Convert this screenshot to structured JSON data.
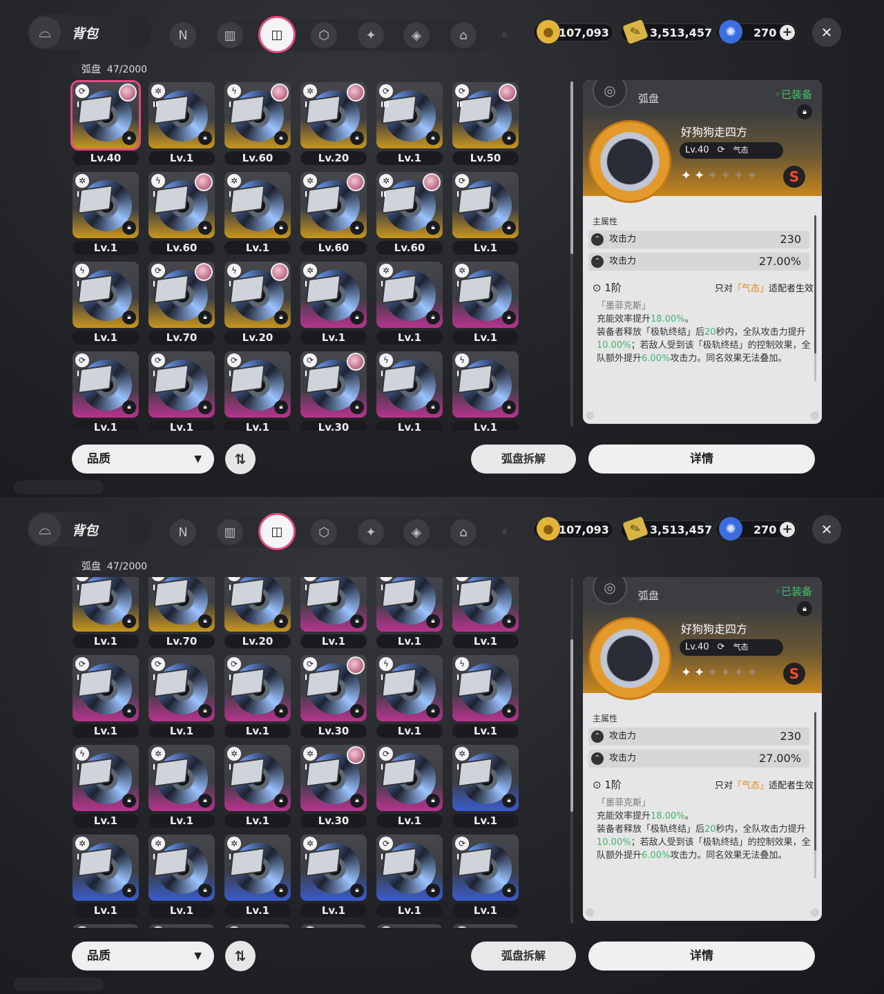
{
  "header": {
    "title": "背包",
    "tabs": [
      {
        "name": "tab-drive-n",
        "icon": "N",
        "active": false
      },
      {
        "name": "tab-device",
        "icon": "▥",
        "active": false
      },
      {
        "name": "tab-disc",
        "icon": "◫",
        "active": true
      },
      {
        "name": "tab-box",
        "icon": "⬡",
        "active": false
      },
      {
        "name": "tab-food",
        "icon": "✦",
        "active": false
      },
      {
        "name": "tab-material",
        "icon": "◈",
        "active": false
      },
      {
        "name": "tab-home",
        "icon": "⌂",
        "active": false
      }
    ],
    "currencies": [
      {
        "name": "gold-coin",
        "value": "107,093",
        "color": "#e3b43a",
        "icon": "●"
      },
      {
        "name": "ticket",
        "value": "3,513,457",
        "color": "#d8b545",
        "icon": "✎"
      },
      {
        "name": "crystal",
        "value": "270",
        "color": "#3b6de0",
        "icon": "✺"
      }
    ],
    "close_icon": "✕"
  },
  "inventory": {
    "category": "弧盘",
    "count": "47/2000"
  },
  "colors": {
    "gold": "#c8961d",
    "purple": "#b8338f",
    "blue": "#3a5bd0",
    "accent": "#e24a80"
  },
  "top_grid": [
    {
      "lv": "Lv.40",
      "q": "gold",
      "rank": "I",
      "attr": "⟳",
      "avatar": true,
      "sel": true
    },
    {
      "lv": "Lv.1",
      "q": "gold",
      "rank": "II",
      "attr": "✲",
      "avatar": false
    },
    {
      "lv": "Lv.60",
      "q": "gold",
      "rank": "I",
      "attr": "ϟ",
      "avatar": true
    },
    {
      "lv": "Lv.20",
      "q": "gold",
      "rank": "I",
      "attr": "✲",
      "avatar": true
    },
    {
      "lv": "Lv.1",
      "q": "gold",
      "rank": "III",
      "attr": "⟳",
      "avatar": false
    },
    {
      "lv": "Lv.50",
      "q": "gold",
      "rank": "II",
      "attr": "⟳",
      "avatar": true
    },
    {
      "lv": "Lv.1",
      "q": "gold",
      "rank": "I",
      "attr": "✲",
      "avatar": false
    },
    {
      "lv": "Lv.60",
      "q": "gold",
      "rank": "I",
      "attr": "ϟ",
      "avatar": true
    },
    {
      "lv": "Lv.1",
      "q": "gold",
      "rank": "I",
      "attr": "✲",
      "avatar": false
    },
    {
      "lv": "Lv.60",
      "q": "gold",
      "rank": "I",
      "attr": "✲",
      "avatar": true
    },
    {
      "lv": "Lv.60",
      "q": "gold",
      "rank": "II",
      "attr": "✲",
      "avatar": true
    },
    {
      "lv": "Lv.1",
      "q": "gold",
      "rank": "I",
      "attr": "⟳",
      "avatar": false
    },
    {
      "lv": "Lv.1",
      "q": "gold",
      "rank": "I",
      "attr": "ϟ",
      "avatar": false
    },
    {
      "lv": "Lv.70",
      "q": "gold",
      "rank": "I",
      "attr": "⟳",
      "avatar": true
    },
    {
      "lv": "Lv.20",
      "q": "gold",
      "rank": "I",
      "attr": "ϟ",
      "avatar": true
    },
    {
      "lv": "Lv.1",
      "q": "purple",
      "rank": "I",
      "attr": "✲",
      "avatar": false
    },
    {
      "lv": "Lv.1",
      "q": "purple",
      "rank": "I",
      "attr": "✲",
      "avatar": false
    },
    {
      "lv": "Lv.1",
      "q": "purple",
      "rank": "I",
      "attr": "✲",
      "avatar": false
    },
    {
      "lv": "Lv.1",
      "q": "purple",
      "rank": "I",
      "attr": "⟳",
      "avatar": false
    },
    {
      "lv": "Lv.1",
      "q": "purple",
      "rank": "I",
      "attr": "⟳",
      "avatar": false
    },
    {
      "lv": "Lv.1",
      "q": "purple",
      "rank": "I",
      "attr": "⟳",
      "avatar": false
    },
    {
      "lv": "Lv.30",
      "q": "purple",
      "rank": "I",
      "attr": "⟳",
      "avatar": true
    },
    {
      "lv": "Lv.1",
      "q": "purple",
      "rank": "I",
      "attr": "ϟ",
      "avatar": false
    },
    {
      "lv": "Lv.1",
      "q": "purple",
      "rank": "I",
      "attr": "ϟ",
      "avatar": false
    }
  ],
  "bottom_grid": [
    {
      "lv": "Lv.1",
      "q": "gold",
      "rank": "I",
      "attr": "ϟ",
      "avatar": false
    },
    {
      "lv": "Lv.70",
      "q": "gold",
      "rank": "I",
      "attr": "⟳",
      "avatar": false
    },
    {
      "lv": "Lv.20",
      "q": "gold",
      "rank": "I",
      "attr": "ϟ",
      "avatar": false
    },
    {
      "lv": "Lv.1",
      "q": "purple",
      "rank": "I",
      "attr": "✲",
      "avatar": false
    },
    {
      "lv": "Lv.1",
      "q": "purple",
      "rank": "I",
      "attr": "✲",
      "avatar": false
    },
    {
      "lv": "Lv.1",
      "q": "purple",
      "rank": "I",
      "attr": "✲",
      "avatar": false
    },
    {
      "lv": "Lv.1",
      "q": "purple",
      "rank": "I",
      "attr": "⟳",
      "avatar": false
    },
    {
      "lv": "Lv.1",
      "q": "purple",
      "rank": "I",
      "attr": "⟳",
      "avatar": false
    },
    {
      "lv": "Lv.1",
      "q": "purple",
      "rank": "I",
      "attr": "⟳",
      "avatar": false
    },
    {
      "lv": "Lv.30",
      "q": "purple",
      "rank": "I",
      "attr": "⟳",
      "avatar": true
    },
    {
      "lv": "Lv.1",
      "q": "purple",
      "rank": "I",
      "attr": "ϟ",
      "avatar": false
    },
    {
      "lv": "Lv.1",
      "q": "purple",
      "rank": "I",
      "attr": "ϟ",
      "avatar": false
    },
    {
      "lv": "Lv.1",
      "q": "purple",
      "rank": "I",
      "attr": "ϟ",
      "avatar": false
    },
    {
      "lv": "Lv.1",
      "q": "purple",
      "rank": "I",
      "attr": "✲",
      "avatar": false
    },
    {
      "lv": "Lv.1",
      "q": "purple",
      "rank": "I",
      "attr": "✲",
      "avatar": false
    },
    {
      "lv": "Lv.30",
      "q": "purple",
      "rank": "I",
      "attr": "✲",
      "avatar": true
    },
    {
      "lv": "Lv.1",
      "q": "purple",
      "rank": "I",
      "attr": "⟳",
      "avatar": false
    },
    {
      "lv": "Lv.1",
      "q": "blue",
      "rank": "I",
      "attr": "✲",
      "avatar": false
    },
    {
      "lv": "Lv.1",
      "q": "blue",
      "rank": "I",
      "attr": "✲",
      "avatar": false
    },
    {
      "lv": "Lv.1",
      "q": "blue",
      "rank": "I",
      "attr": "✲",
      "avatar": false
    },
    {
      "lv": "Lv.1",
      "q": "blue",
      "rank": "I",
      "attr": "✲",
      "avatar": false
    },
    {
      "lv": "Lv.1",
      "q": "blue",
      "rank": "I",
      "attr": "✲",
      "avatar": false
    },
    {
      "lv": "Lv.1",
      "q": "blue",
      "rank": "I",
      "attr": "⟳",
      "avatar": false
    },
    {
      "lv": "Lv.1",
      "q": "blue",
      "rank": "I",
      "attr": "⟳",
      "avatar": false
    },
    {
      "lv": "",
      "q": "blue",
      "rank": "I",
      "attr": "⟳",
      "avatar": false
    },
    {
      "lv": "",
      "q": "blue",
      "rank": "I",
      "attr": "⟳",
      "avatar": false
    },
    {
      "lv": "",
      "q": "blue",
      "rank": "I",
      "attr": "⟳",
      "avatar": false
    },
    {
      "lv": "",
      "q": "blue",
      "rank": "I",
      "attr": "⟳",
      "avatar": false
    },
    {
      "lv": "",
      "q": "blue",
      "rank": "I",
      "attr": "⟳",
      "avatar": false
    },
    {
      "lv": "",
      "q": "blue",
      "rank": "I",
      "attr": "⟳",
      "avatar": false
    }
  ],
  "detail": {
    "category": "弧盘",
    "equipped": "◦已装备",
    "name": "好狗狗走四方",
    "level": "Lv.40",
    "attribute": "气态",
    "stars_total": 6,
    "stars_on": 2,
    "rank_letter": "S",
    "main_stat_title": "主属性",
    "stats": [
      {
        "label": "攻击力",
        "value": "230"
      },
      {
        "label": "攻击力",
        "value": "27.00%"
      }
    ],
    "skill_tier": "1阶",
    "skill_cond_pre": "只对",
    "skill_cond_hl": "「气态」",
    "skill_cond_post": "适配者生效",
    "skill_source": "「墨菲克斯」",
    "skill_text": [
      {
        "t": "充能效率提升",
        "g": false
      },
      {
        "t": "18.00%",
        "g": true
      },
      {
        "t": "。",
        "g": false
      },
      {
        "t": "\n",
        "g": false
      },
      {
        "t": "装备者释放「极轨终结」后",
        "g": false
      },
      {
        "t": "20",
        "g": true
      },
      {
        "t": "秒内，全队攻击力提升",
        "g": false
      },
      {
        "t": "10.00%",
        "g": true
      },
      {
        "t": "；若敌人受到该「极轨终结」的控制效果，全队额外提升",
        "g": false
      },
      {
        "t": "6.00%",
        "g": true
      },
      {
        "t": "攻击力。同名效果无法叠加。",
        "g": false
      }
    ]
  },
  "footer": {
    "filter_label": "品质",
    "sort_icon": "⇅",
    "dismantle_label": "弧盘拆解",
    "details_label": "详情"
  },
  "scroll": {
    "top_position": 0.0,
    "bottom_position": 0.35
  }
}
